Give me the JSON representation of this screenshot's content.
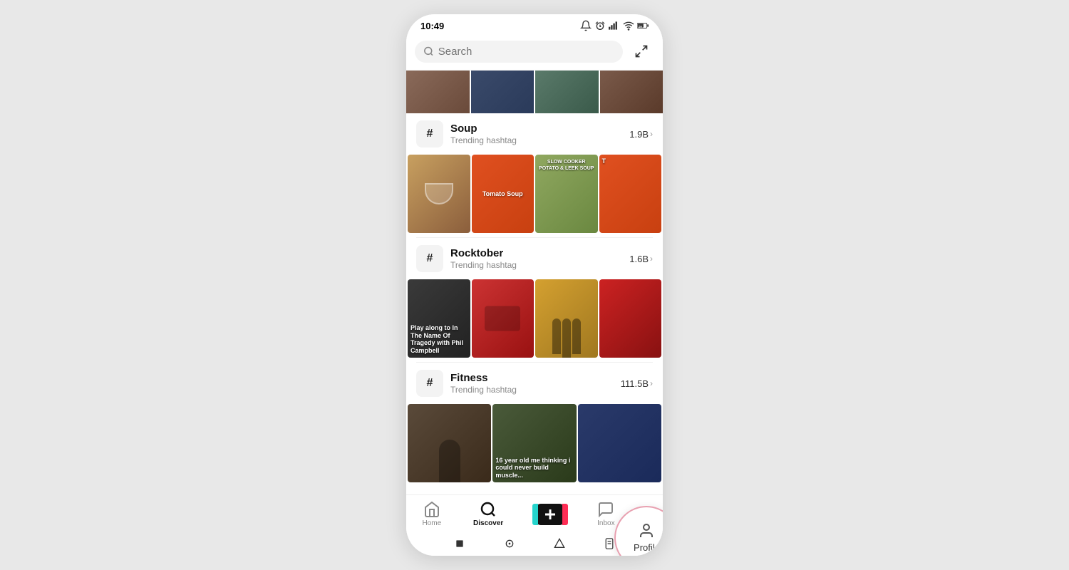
{
  "statusBar": {
    "time": "10:49",
    "batteryLevel": "59"
  },
  "search": {
    "placeholder": "Search"
  },
  "hashtags": [
    {
      "id": "soup",
      "name": "Soup",
      "subtitle": "Trending hashtag",
      "count": "1.9B",
      "thumbLabels": [
        "",
        "Tomato Soup",
        "SLOW COOKER POTATO & LEEK SOUP",
        ""
      ]
    },
    {
      "id": "rocktober",
      "name": "Rocktober",
      "subtitle": "Trending hashtag",
      "count": "1.6B",
      "thumbLabels": [
        "Play along to In The Name Of Tragedy with Phil Campbell",
        "",
        "",
        ""
      ]
    },
    {
      "id": "fitness",
      "name": "Fitness",
      "subtitle": "Trending hashtag",
      "count": "111.5B",
      "thumbLabels": [
        "",
        "16 year old me thinking i could never build muscle...",
        "",
        ""
      ]
    }
  ],
  "bottomNav": {
    "items": [
      {
        "id": "home",
        "label": "Home",
        "active": false
      },
      {
        "id": "discover",
        "label": "Discover",
        "active": true
      },
      {
        "id": "add",
        "label": "+",
        "active": false
      },
      {
        "id": "inbox",
        "label": "Inbox",
        "active": false
      },
      {
        "id": "profile",
        "label": "Profile",
        "active": false
      }
    ]
  },
  "profileHighlight": {
    "label": "Profile"
  }
}
